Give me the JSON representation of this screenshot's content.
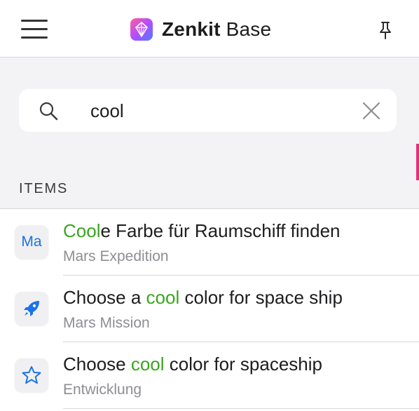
{
  "header": {
    "title_bold": "Zenkit",
    "title_light": "Base",
    "menu_icon": "hamburger-menu-icon",
    "logo_icon": "zenkit-diamond-logo",
    "pin_icon": "pin-icon"
  },
  "search": {
    "value": "cool",
    "placeholder": "",
    "search_icon": "magnifier-icon",
    "clear_icon": "close-x-icon"
  },
  "section": {
    "label": "ITEMS"
  },
  "items": [
    {
      "title_pre": "",
      "title_hl": "Cool",
      "title_post": "e Farbe für Raumschiff finden",
      "subtitle": "Mars Expedition",
      "avatar_text": "Ma",
      "avatar_icon": ""
    },
    {
      "title_pre": "Choose a ",
      "title_hl": "cool",
      "title_post": " color for space ship",
      "subtitle": "Mars Mission",
      "avatar_text": "",
      "avatar_icon": "rocket-icon"
    },
    {
      "title_pre": "Choose ",
      "title_hl": "cool",
      "title_post": " color for spaceship",
      "subtitle": "Entwicklung",
      "avatar_text": "",
      "avatar_icon": "star-outline-icon"
    }
  ],
  "colors": {
    "highlight": "#3aa61e",
    "accent_blue": "#1a73e8",
    "subtitle_gray": "#8e8e93",
    "background": "#f3f3f5"
  }
}
